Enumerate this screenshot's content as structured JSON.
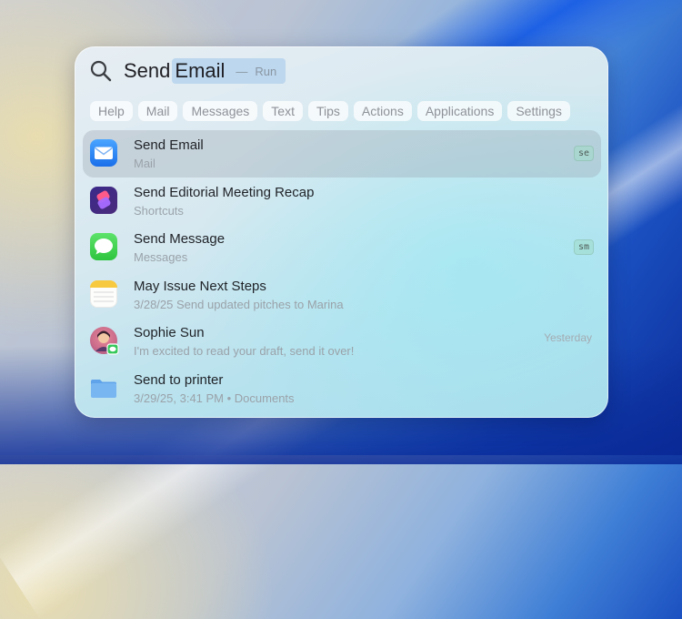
{
  "search": {
    "typed": "Send",
    "completion": "Email",
    "separator": "—",
    "action": "Run"
  },
  "filters": [
    "Help",
    "Mail",
    "Messages",
    "Text",
    "Tips",
    "Actions",
    "Applications",
    "Settings"
  ],
  "results": [
    {
      "title": "Send Email",
      "subtitle": "Mail",
      "badge": "se",
      "meta": "",
      "icon": "mail-icon",
      "selected": true
    },
    {
      "title": "Send Editorial Meeting Recap",
      "subtitle": "Shortcuts",
      "badge": "",
      "meta": "",
      "icon": "shortcuts-icon",
      "selected": false
    },
    {
      "title": "Send Message",
      "subtitle": "Messages",
      "badge": "sm",
      "meta": "",
      "icon": "messages-icon",
      "selected": false
    },
    {
      "title": "May Issue Next Steps",
      "subtitle": "3/28/25 Send updated pitches to Marina",
      "badge": "",
      "meta": "",
      "icon": "notes-icon",
      "selected": false
    },
    {
      "title": "Sophie Sun",
      "subtitle": "I'm excited to read your draft, send it over!",
      "badge": "",
      "meta": "Yesterday",
      "icon": "contact-avatar-icon",
      "selected": false
    },
    {
      "title": "Send to printer",
      "subtitle": "3/29/25, 3:41 PM • Documents",
      "badge": "",
      "meta": "",
      "icon": "folder-icon",
      "selected": false
    }
  ],
  "colors": {
    "accent_selection": "#bcd7ee",
    "selected_row": "#a9b2ba",
    "mail_blue": "#1a6fea",
    "messages_green": "#2ec53f"
  }
}
